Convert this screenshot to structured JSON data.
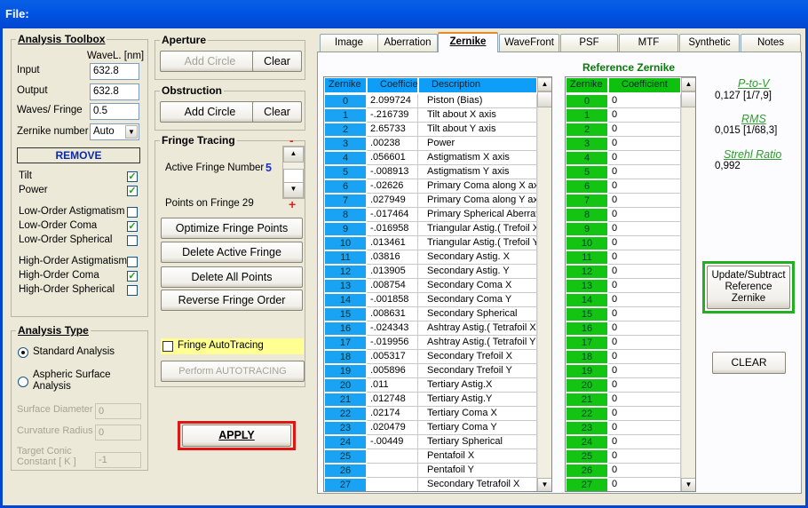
{
  "window": {
    "title": "File:"
  },
  "toolbox": {
    "title": "Analysis Toolbox",
    "wavel_header": "WaveL. [nm]",
    "input_label": "Input",
    "input_value": "632.8",
    "output_label": "Output",
    "output_value": "632.8",
    "waves_label": "Waves/ Fringe",
    "waves_value": "0.5",
    "zernike_label": "Zernike number",
    "zernike_value": "Auto",
    "remove_label": "REMOVE",
    "checks": [
      {
        "label": "Tilt",
        "checked": true
      },
      {
        "label": "Power",
        "checked": true
      },
      {
        "label": "Low-Order Astigmatism",
        "checked": false
      },
      {
        "label": "Low-Order Coma",
        "checked": true
      },
      {
        "label": "Low-Order Spherical",
        "checked": false
      },
      {
        "label": "High-Order Astigmatism",
        "checked": false
      },
      {
        "label": "High-Order Coma",
        "checked": true
      },
      {
        "label": "High-Order Spherical",
        "checked": false
      }
    ]
  },
  "analysis": {
    "title": "Analysis Type",
    "standard": "Standard Analysis",
    "aspheric": "Aspheric  Surface Analysis",
    "surface_diameter": "Surface Diameter",
    "surface_diameter_value": "0",
    "curvature_radius": "Curvature Radius",
    "curvature_radius_value": "0",
    "target_conic": "Target Conic Constant [ K ]",
    "target_conic_value": "-1"
  },
  "aperture": {
    "title": "Aperture",
    "add": "Add Circle",
    "clear": "Clear"
  },
  "obstruction": {
    "title": "Obstruction",
    "add": "Add Circle",
    "clear": "Clear"
  },
  "fringe": {
    "title": "Fringe Tracing",
    "minus": "-",
    "plus": "+",
    "active_label": "Active Fringe Number",
    "active_value": "5",
    "points_label": "Points on  Fringe 29",
    "optimize": "Optimize Fringe Points",
    "delete_active": "Delete Active Fringe",
    "delete_all": "Delete  All Points",
    "reverse": "Reverse  Fringe Order",
    "autotracing": "Fringe AutoTracing",
    "perform": "Perform  AUTOTRACING"
  },
  "apply": "APPLY",
  "tabs": [
    "Image",
    "Aberration",
    "Zernike",
    "WaveFront",
    "PSF",
    "MTF",
    "Synthetic",
    "Notes"
  ],
  "zernike_table": {
    "headers": [
      "Zernike",
      "Coefficie",
      "Description"
    ],
    "rows": [
      [
        "0",
        "2.099724",
        "Piston (Bias)"
      ],
      [
        "1",
        "-.216739",
        "Tilt about X axis"
      ],
      [
        "2",
        "2.65733",
        "Tilt about Y axis"
      ],
      [
        "3",
        ".00238",
        "Power"
      ],
      [
        "4",
        ".056601",
        "Astigmatism X axis"
      ],
      [
        "5",
        "-.008913",
        "Astigmatism Y axis"
      ],
      [
        "6",
        "-.02626",
        "Primary Coma along X axis"
      ],
      [
        "7",
        ".027949",
        "Primary Coma along Y axis"
      ],
      [
        "8",
        "-.017464",
        "Primary Spherical Aberration"
      ],
      [
        "9",
        "-.016958",
        "Triangular Astig.( Trefoil X"
      ],
      [
        "10",
        ".013461",
        "Triangular Astig.( Trefoil Y"
      ],
      [
        "11",
        ".03816",
        "Secondary Astig. X"
      ],
      [
        "12",
        ".013905",
        "Secondary Astig. Y"
      ],
      [
        "13",
        ".008754",
        "Secondary Coma X"
      ],
      [
        "14",
        "-.001858",
        "Secondary Coma Y"
      ],
      [
        "15",
        ".008631",
        "Secondary Spherical"
      ],
      [
        "16",
        "-.024343",
        "Ashtray Astig.( Tetrafoil X"
      ],
      [
        "17",
        "-.019956",
        "Ashtray Astig.( Tetrafoil Y"
      ],
      [
        "18",
        ".005317",
        "Secondary Trefoil X"
      ],
      [
        "19",
        ".005896",
        "Secondary Trefoil Y"
      ],
      [
        "20",
        ".011",
        "Tertiary Astig.X"
      ],
      [
        "21",
        ".012748",
        "Tertiary Astig.Y"
      ],
      [
        "22",
        ".02174",
        "Tertiary Coma X"
      ],
      [
        "23",
        ".020479",
        "Tertiary Coma Y"
      ],
      [
        "24",
        "-.00449",
        "Tertiary Spherical"
      ],
      [
        "25",
        "",
        "Pentafoil X"
      ],
      [
        "26",
        "",
        "Pentafoil Y"
      ],
      [
        "27",
        "",
        "Secondary Tetrafoil X"
      ]
    ]
  },
  "reference": {
    "title": "Reference Zernike",
    "headers": [
      "Zernike",
      "Coefficient"
    ],
    "values": [
      "0",
      "0",
      "0",
      "0",
      "0",
      "0",
      "0",
      "0",
      "0",
      "0",
      "0",
      "0",
      "0",
      "0",
      "0",
      "0",
      "0",
      "0",
      "0",
      "0",
      "0",
      "0",
      "0",
      "0",
      "0",
      "0",
      "0",
      "0"
    ]
  },
  "stats": {
    "ptov_label": "P-to-V",
    "ptov_value": "0,127  [1/7,9]",
    "rms_label": "RMS",
    "rms_value": "0,015  [1/68,3]",
    "strehl_label": "Strehl Ratio",
    "strehl_value": "0,992"
  },
  "update_button": "Update/Subtract Reference Zernike",
  "clear_button": "CLEAR"
}
